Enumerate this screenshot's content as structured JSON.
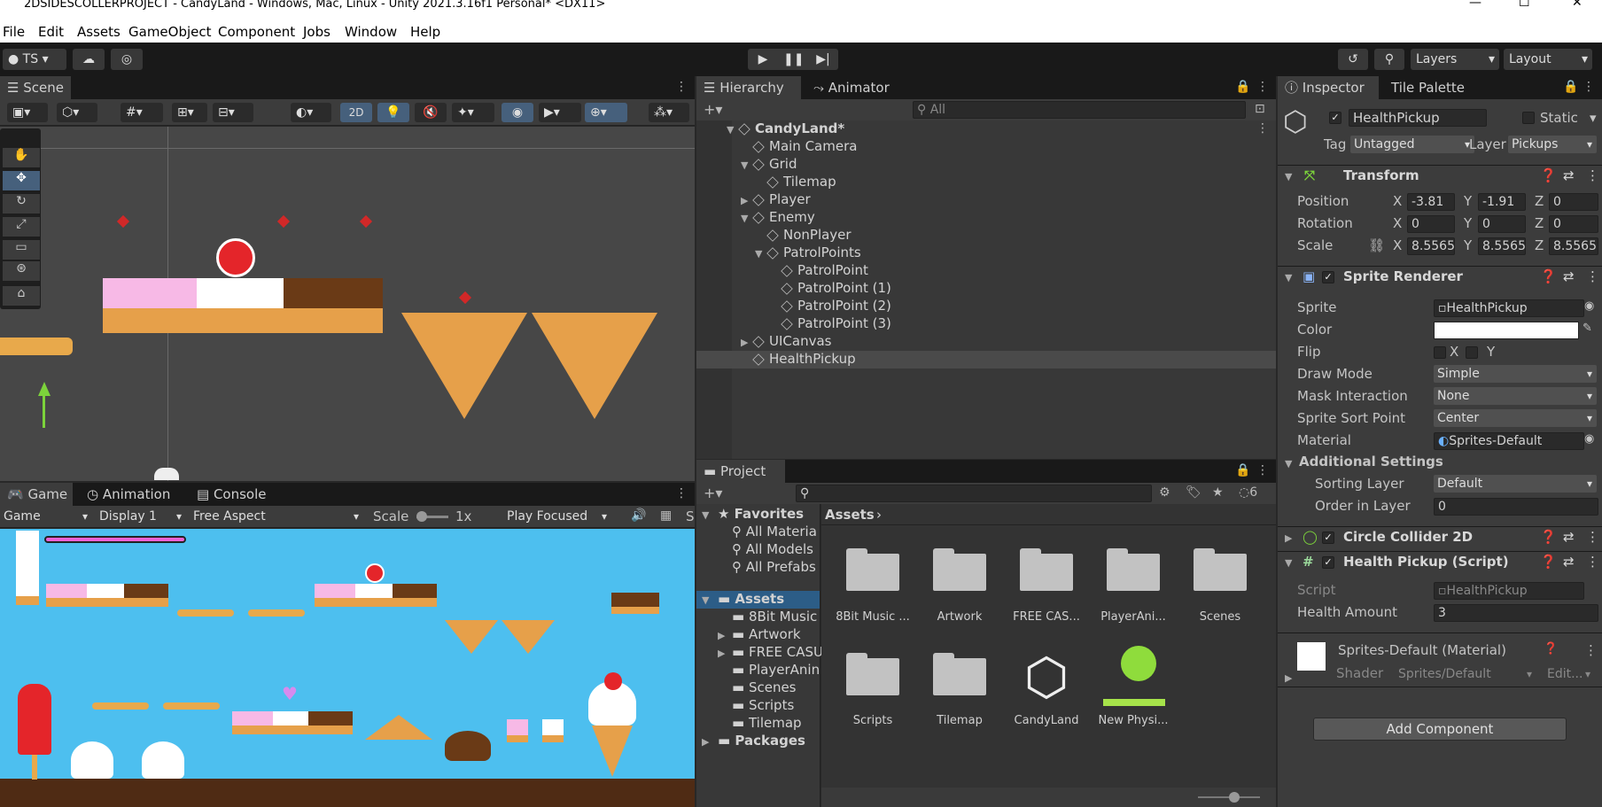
{
  "window": {
    "title": "2DSIDESCOLLERPROJECT - CandyLand - Windows, Mac, Linux - Unity 2021.3.16f1 Personal* <DX11>"
  },
  "menu": [
    "File",
    "Edit",
    "Assets",
    "GameObject",
    "Component",
    "Jobs",
    "Window",
    "Help"
  ],
  "toolbar": {
    "account": "TS",
    "layers": "Layers",
    "layout": "Layout"
  },
  "scene": {
    "tab": "Scene",
    "mode2d": "2D"
  },
  "game": {
    "tabs": [
      "Game",
      "Animation",
      "Console"
    ],
    "view": "Game",
    "display": "Display 1",
    "aspect": "Free Aspect",
    "scale_label": "Scale",
    "scale_value": "1x",
    "play_mode": "Play Focused",
    "tail": "S"
  },
  "hierarchy": {
    "tabs": [
      "Hierarchy",
      "Animator"
    ],
    "search_placeholder": "All",
    "items": [
      {
        "name": "CandyLand*",
        "indent": 0,
        "arrow": "▼",
        "bold": true
      },
      {
        "name": "Main Camera",
        "indent": 1,
        "arrow": ""
      },
      {
        "name": "Grid",
        "indent": 1,
        "arrow": "▼"
      },
      {
        "name": "Tilemap",
        "indent": 2,
        "arrow": ""
      },
      {
        "name": "Player",
        "indent": 1,
        "arrow": "▶"
      },
      {
        "name": "Enemy",
        "indent": 1,
        "arrow": "▼"
      },
      {
        "name": "NonPlayer",
        "indent": 2,
        "arrow": ""
      },
      {
        "name": "PatrolPoints",
        "indent": 2,
        "arrow": "▼"
      },
      {
        "name": "PatrolPoint",
        "indent": 3,
        "arrow": ""
      },
      {
        "name": "PatrolPoint (1)",
        "indent": 3,
        "arrow": ""
      },
      {
        "name": "PatrolPoint (2)",
        "indent": 3,
        "arrow": ""
      },
      {
        "name": "PatrolPoint (3)",
        "indent": 3,
        "arrow": ""
      },
      {
        "name": "UICanvas",
        "indent": 1,
        "arrow": "▶"
      },
      {
        "name": "HealthPickup",
        "indent": 1,
        "arrow": "",
        "selected": true
      }
    ]
  },
  "project": {
    "tab": "Project",
    "search_count": "6",
    "breadcrumb": "Assets",
    "favorites": {
      "label": "Favorites",
      "items": [
        "All Materia",
        "All Models",
        "All Prefabs"
      ]
    },
    "tree": {
      "label": "Assets",
      "items": [
        "8Bit Music",
        "Artwork",
        "FREE CASU",
        "PlayerAnin",
        "Scenes",
        "Scripts",
        "Tilemap"
      ],
      "packages": "Packages"
    },
    "grid": [
      "8Bit Music ...",
      "Artwork",
      "FREE CAS...",
      "PlayerAni...",
      "Scenes",
      "Scripts",
      "Tilemap",
      "CandyLand",
      "New Physi..."
    ]
  },
  "inspector": {
    "tabs": [
      "Inspector",
      "Tile Palette"
    ],
    "object_name": "HealthPickup",
    "static_label": "Static",
    "tag_label": "Tag",
    "tag": "Untagged",
    "layer_label": "Layer",
    "layer": "Pickups",
    "transform": {
      "title": "Transform",
      "position": {
        "label": "Position",
        "x": "-3.81",
        "y": "-1.91",
        "z": "0"
      },
      "rotation": {
        "label": "Rotation",
        "x": "0",
        "y": "0",
        "z": "0"
      },
      "scale": {
        "label": "Scale",
        "x": "8.5565",
        "y": "8.5565",
        "z": "8.5565"
      }
    },
    "sprite_renderer": {
      "title": "Sprite Renderer",
      "sprite_label": "Sprite",
      "sprite": "HealthPickup",
      "color_label": "Color",
      "flip_label": "Flip",
      "flip_x": "X",
      "flip_y": "Y",
      "draw_mode_label": "Draw Mode",
      "draw_mode": "Simple",
      "mask_label": "Mask Interaction",
      "mask": "None",
      "sort_point_label": "Sprite Sort Point",
      "sort_point": "Center",
      "material_label": "Material",
      "material": "Sprites-Default",
      "additional": "Additional Settings",
      "sorting_layer_label": "Sorting Layer",
      "sorting_layer": "Default",
      "order_label": "Order in Layer",
      "order": "0"
    },
    "collider": {
      "title": "Circle Collider 2D"
    },
    "script_comp": {
      "title": "Health Pickup (Script)",
      "script_label": "Script",
      "script": "HealthPickup",
      "amount_label": "Health Amount",
      "amount": "3"
    },
    "material": {
      "title": "Sprites-Default (Material)",
      "shader_label": "Shader",
      "shader": "Sprites/Default",
      "edit": "Edit..."
    },
    "add_component": "Add Component"
  },
  "colors": {
    "accent_selection": "#2c5d87",
    "sky": "#4dbfef",
    "play_accent": "#3a79bb"
  }
}
